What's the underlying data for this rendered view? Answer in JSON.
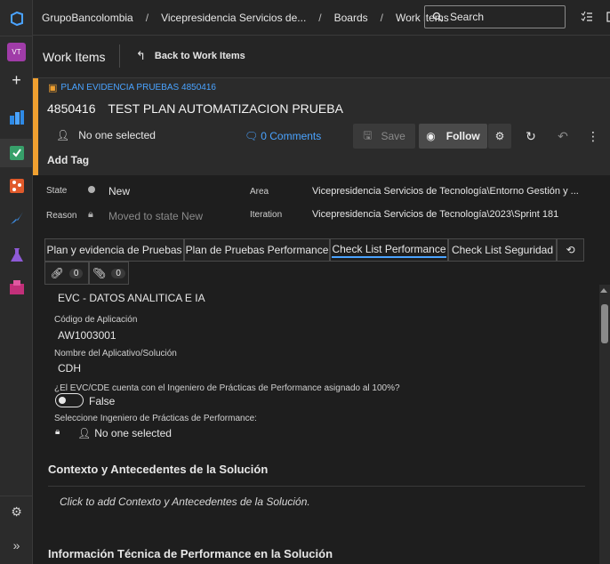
{
  "nav": {
    "avatar_initials": "VT",
    "items": [
      {
        "icon": "plus-icon"
      },
      {
        "icon": "boards-icon"
      },
      {
        "icon": "boards-check-icon"
      },
      {
        "icon": "repos-icon"
      },
      {
        "icon": "pipelines-icon"
      },
      {
        "icon": "test-plans-icon"
      },
      {
        "icon": "artifacts-icon"
      }
    ],
    "settings_icon": "gear-icon",
    "expand_icon": "chevron-double-right-icon"
  },
  "breadcrumb": {
    "org": "GrupoBancolombia",
    "project": "Vicepresidencia Servicios de...",
    "boards": "Boards",
    "work_items": "Work items"
  },
  "search": {
    "placeholder": "Search"
  },
  "header": {
    "title": "Work Items",
    "back_label": "Back to Work Items"
  },
  "work_item": {
    "type_label": "PLAN EVIDENCIA PRUEBAS 4850416",
    "id": "4850416",
    "title": "TEST PLAN AUTOMATIZACION PRUEBA",
    "assigned": "No one selected",
    "comments": "0 Comments",
    "save_label": "Save",
    "follow_label": "Follow",
    "add_tag_label": "Add Tag",
    "accent_color": "#f0a030"
  },
  "fields": {
    "state_label": "State",
    "state_value": "New",
    "reason_label": "Reason",
    "reason_value": "Moved to state New",
    "area_label": "Area",
    "area_value": "Vicepresidencia Servicios de Tecnología\\Entorno Gestión y ...",
    "iteration_label": "Iteration",
    "iteration_value": "Vicepresidencia Servicios de Tecnología\\2023\\Sprint 181"
  },
  "tabs": [
    {
      "label": "Plan y evidencia de Pruebas"
    },
    {
      "label": "Plan de Pruebas Performance"
    },
    {
      "label": "Check List Performance"
    },
    {
      "label": "Check List Seguridad"
    }
  ],
  "links_count": "0",
  "attachments_count": "0",
  "form": {
    "evc_value": "EVC - DATOS ANALITICA E IA",
    "codigo_label": "Código de Aplicación",
    "codigo_value": "AW1003001",
    "nombre_label": "Nombre del Aplicativo/Solución",
    "nombre_value": "CDH",
    "ingeniero_question": "¿El EVC/CDE cuenta con el Ingeniero de Prácticas de Performance asignado al 100%?",
    "toggle_value": "False",
    "seleccione_label": "Seleccione Ingeniero de Prácticas de Performance:",
    "seleccione_value": "No one selected",
    "contexto_heading": "Contexto y Antecedentes de la Solución",
    "contexto_placeholder": "Click to add Contexto y Antecedentes de la Solución.",
    "info_heading": "Información Técnica de Performance en la Solución"
  }
}
